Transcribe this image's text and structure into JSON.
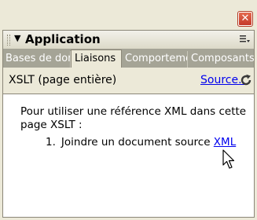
{
  "window": {
    "close_glyph": "✕"
  },
  "panel": {
    "title": "Application",
    "collapse_glyph": "▼"
  },
  "tabs": [
    {
      "label": "Bases de données",
      "active": false
    },
    {
      "label": "Liaisons",
      "active": true
    },
    {
      "label": "Comportements",
      "active": false
    },
    {
      "label": "Composants",
      "active": false
    }
  ],
  "toolbar": {
    "label": "XSLT (page entière)",
    "source_link": "Source..",
    "refresh_icon": "refresh-icon"
  },
  "content": {
    "instruction": "Pour utiliser une référence XML dans cette page XSLT :",
    "steps": [
      {
        "number": "1.",
        "text": "Joindre un document source ",
        "link": "XML"
      }
    ]
  },
  "colors": {
    "frame": "#ece9d8",
    "tabbar": "#a5a496",
    "link": "#0000ee",
    "close": "#c4382a"
  }
}
